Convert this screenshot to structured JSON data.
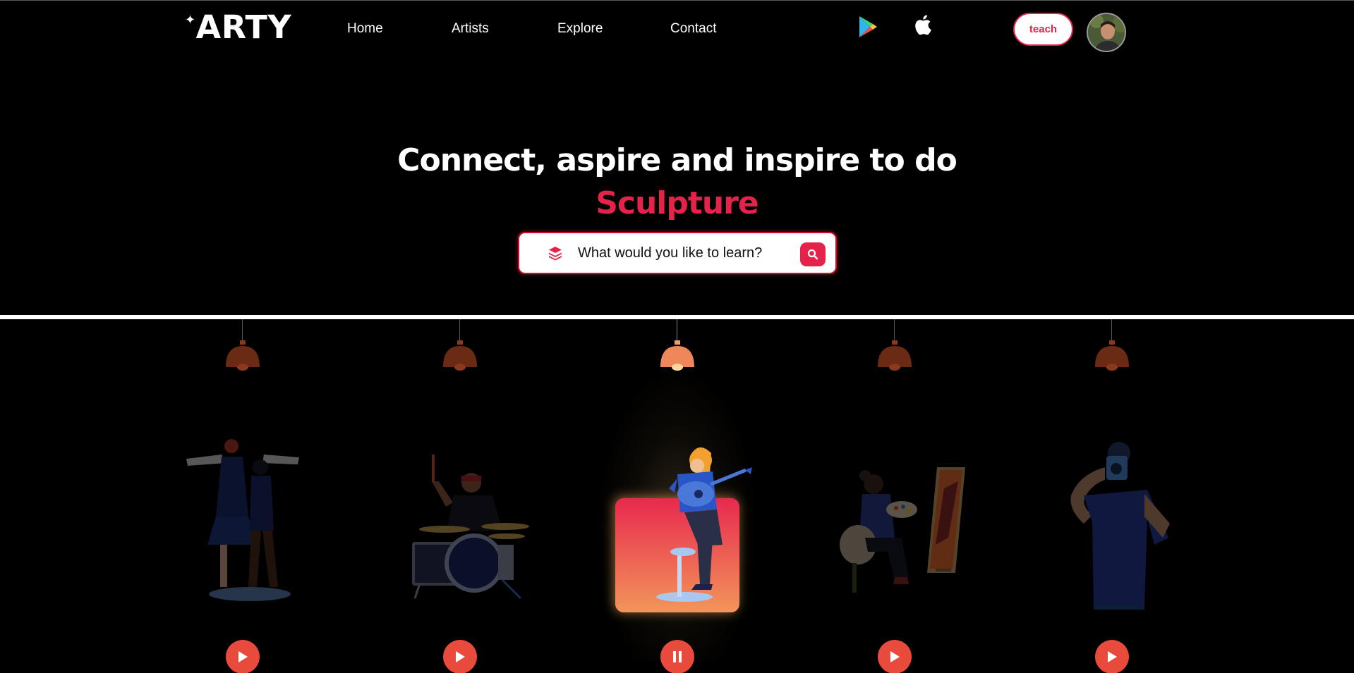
{
  "brand": {
    "spark": "✦",
    "name": "ARTY"
  },
  "nav": {
    "items": [
      {
        "label": "Home"
      },
      {
        "label": "Artists"
      },
      {
        "label": "Explore"
      },
      {
        "label": "Contact"
      }
    ]
  },
  "stores": {
    "play_icon": "google-play-icon",
    "apple_icon": "apple-icon"
  },
  "header": {
    "teach_label": "teach",
    "avatar_icon": "user-avatar"
  },
  "hero": {
    "headline": "Connect, aspire and inspire to do",
    "highlight": "Sculpture",
    "search_placeholder": "What would you like to learn?"
  },
  "stage": {
    "active_index": 2,
    "items": [
      {
        "figure": "dancers-illustration",
        "control": "play"
      },
      {
        "figure": "drummer-illustration",
        "control": "play"
      },
      {
        "figure": "guitarist-illustration",
        "control": "pause"
      },
      {
        "figure": "painter-illustration",
        "control": "play"
      },
      {
        "figure": "photographer-illustration",
        "control": "play"
      }
    ]
  },
  "colors": {
    "accent": "#e3234a",
    "lamp_off": "#6b2a14",
    "lamp_on": "#f0875a",
    "control": "#e84a3b",
    "card_top": "#e8294e",
    "card_bottom": "#f2955a"
  }
}
